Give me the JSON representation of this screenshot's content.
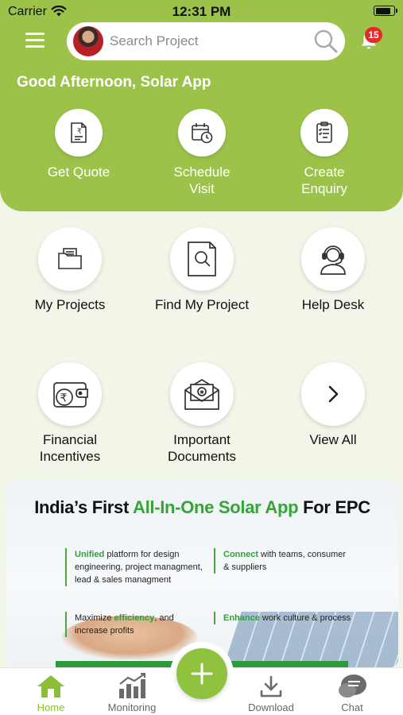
{
  "status_bar": {
    "carrier": "Carrier",
    "time": "12:31 PM",
    "battery_level": 0.9
  },
  "header": {
    "search_placeholder": "Search Project",
    "notification_count": "15",
    "greeting": "Good Afternoon, Solar App"
  },
  "quick_actions": [
    {
      "label": "Get Quote",
      "icon": "quote-document-icon"
    },
    {
      "label": "Schedule\nVisit",
      "icon": "calendar-clock-icon"
    },
    {
      "label": "Create\nEnquiry",
      "icon": "clipboard-enquiry-icon"
    }
  ],
  "tiles": [
    {
      "label": "My Projects",
      "icon": "folder-icon"
    },
    {
      "label": "Find My Project",
      "icon": "document-search-icon"
    },
    {
      "label": "Help Desk",
      "icon": "support-agent-icon"
    },
    {
      "label": "Financial\nIncentives",
      "icon": "rupee-wallet-icon"
    },
    {
      "label": "Important\nDocuments",
      "icon": "envelope-badge-icon"
    },
    {
      "label": "View All",
      "icon": "chevron-right-icon"
    }
  ],
  "banner": {
    "title_prefix": "India’s First ",
    "title_highlight": "All-In-One Solar App",
    "title_suffix": " For EPC",
    "features": [
      {
        "highlight": "Unified",
        "text": " platform for design engineering, project managment, lead & sales managment"
      },
      {
        "highlight": "Connect",
        "text": " with teams, consumer & suppliers"
      },
      {
        "pre": "Maximize ",
        "highlight": "efficiency",
        "text": ", and increase profits"
      },
      {
        "highlight": "Enhance",
        "text": " work culture & process"
      }
    ]
  },
  "tabbar": {
    "tabs": [
      {
        "label": "Home",
        "icon": "home-icon",
        "active": true
      },
      {
        "label": "Monitoring",
        "icon": "bar-chart-icon",
        "active": false
      },
      {
        "label": "Download",
        "icon": "download-icon",
        "active": false
      },
      {
        "label": "Chat",
        "icon": "chat-icon",
        "active": false
      }
    ]
  },
  "colors": {
    "brand_green": "#9cc24a",
    "fab_green": "#8fc23f",
    "badge_red": "#e32b2b",
    "background": "#f2f6e8"
  }
}
